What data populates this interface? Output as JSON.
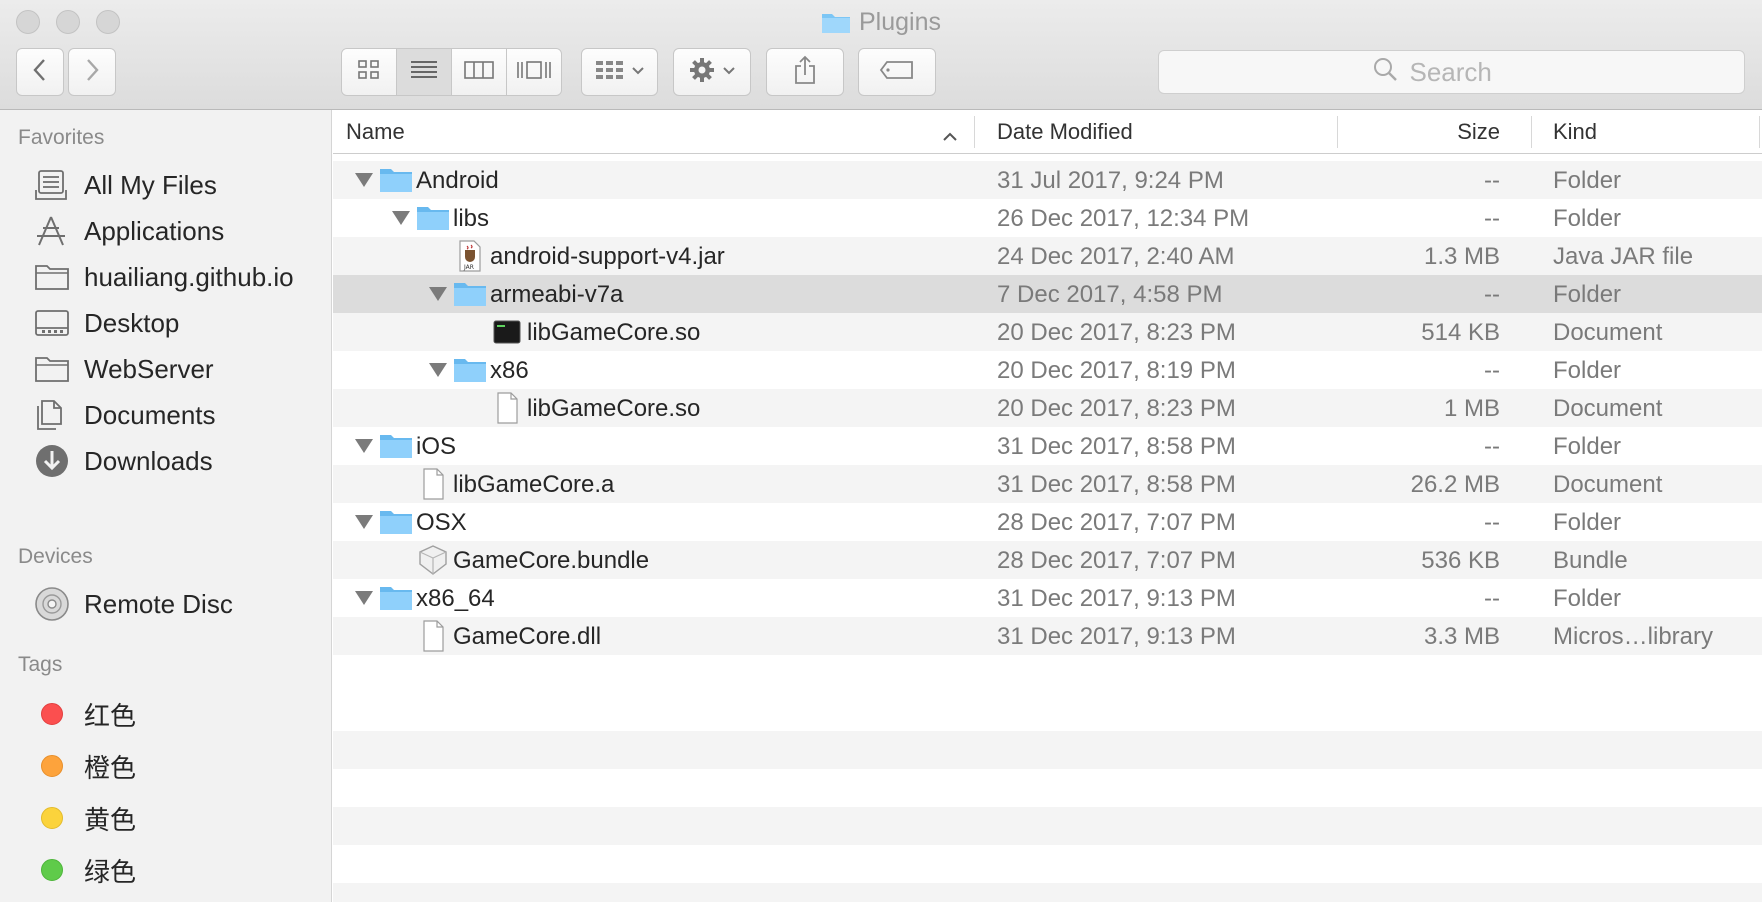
{
  "window": {
    "title": "Plugins"
  },
  "toolbar": {
    "back_icon": "chevron-left-icon",
    "forward_icon": "chevron-right-icon",
    "view_modes": [
      "icon-view",
      "list-view",
      "column-view",
      "cover-flow-view"
    ],
    "active_view": "list-view",
    "arrange_icon": "arrange-grid-icon",
    "action_icon": "gear-icon",
    "share_icon": "share-icon",
    "tag_icon": "tag-icon",
    "search_placeholder": "Search"
  },
  "sidebar": {
    "favorites_heading": "Favorites",
    "favorites": [
      {
        "label": "All My Files",
        "icon": "all-files-icon"
      },
      {
        "label": "Applications",
        "icon": "applications-icon"
      },
      {
        "label": "huailiang.github.io",
        "icon": "folder-icon"
      },
      {
        "label": "Desktop",
        "icon": "desktop-icon"
      },
      {
        "label": "WebServer",
        "icon": "folder-icon"
      },
      {
        "label": "Documents",
        "icon": "documents-icon"
      },
      {
        "label": "Downloads",
        "icon": "downloads-icon"
      }
    ],
    "devices_heading": "Devices",
    "devices": [
      {
        "label": "Remote Disc",
        "icon": "disc-icon"
      }
    ],
    "tags_heading": "Tags",
    "tags": [
      {
        "label": "红色",
        "color": "#fb4f4f"
      },
      {
        "label": "橙色",
        "color": "#fda33c"
      },
      {
        "label": "黄色",
        "color": "#fbd33c"
      },
      {
        "label": "绿色",
        "color": "#5fcb4a"
      }
    ]
  },
  "columns": {
    "name": "Name",
    "date": "Date Modified",
    "size": "Size",
    "kind": "Kind"
  },
  "files": [
    {
      "name": "Android",
      "date": "31 Jul 2017, 9:24 PM",
      "size": "--",
      "kind": "Folder",
      "level": 0,
      "type": "folder",
      "expanded": true
    },
    {
      "name": "libs",
      "date": "26 Dec 2017, 12:34 PM",
      "size": "--",
      "kind": "Folder",
      "level": 1,
      "type": "folder",
      "expanded": true
    },
    {
      "name": "android-support-v4.jar",
      "date": "24 Dec 2017, 2:40 AM",
      "size": "1.3 MB",
      "kind": "Java JAR file",
      "level": 2,
      "type": "jar"
    },
    {
      "name": "armeabi-v7a",
      "date": "7 Dec 2017, 4:58 PM",
      "size": "--",
      "kind": "Folder",
      "level": 2,
      "type": "folder",
      "expanded": true,
      "selected": true
    },
    {
      "name": "libGameCore.so",
      "date": "20 Dec 2017, 8:23 PM",
      "size": "514 KB",
      "kind": "Document",
      "level": 3,
      "type": "exec"
    },
    {
      "name": "x86",
      "date": "20 Dec 2017, 8:19 PM",
      "size": "--",
      "kind": "Folder",
      "level": 2,
      "type": "folder",
      "expanded": true
    },
    {
      "name": "libGameCore.so",
      "date": "20 Dec 2017, 8:23 PM",
      "size": "1 MB",
      "kind": "Document",
      "level": 3,
      "type": "doc"
    },
    {
      "name": "iOS",
      "date": "31 Dec 2017, 8:58 PM",
      "size": "--",
      "kind": "Folder",
      "level": 0,
      "type": "folder",
      "expanded": true
    },
    {
      "name": "libGameCore.a",
      "date": "31 Dec 2017, 8:58 PM",
      "size": "26.2 MB",
      "kind": "Document",
      "level": 1,
      "type": "doc"
    },
    {
      "name": "OSX",
      "date": "28 Dec 2017, 7:07 PM",
      "size": "--",
      "kind": "Folder",
      "level": 0,
      "type": "folder",
      "expanded": true
    },
    {
      "name": "GameCore.bundle",
      "date": "28 Dec 2017, 7:07 PM",
      "size": "536 KB",
      "kind": "Bundle",
      "level": 1,
      "type": "bundle"
    },
    {
      "name": "x86_64",
      "date": "31 Dec 2017, 9:13 PM",
      "size": "--",
      "kind": "Folder",
      "level": 0,
      "type": "folder",
      "expanded": true
    },
    {
      "name": "GameCore.dll",
      "date": "31 Dec 2017, 9:13 PM",
      "size": "3.3 MB",
      "kind": "Micros…library",
      "level": 1,
      "type": "doc"
    }
  ]
}
